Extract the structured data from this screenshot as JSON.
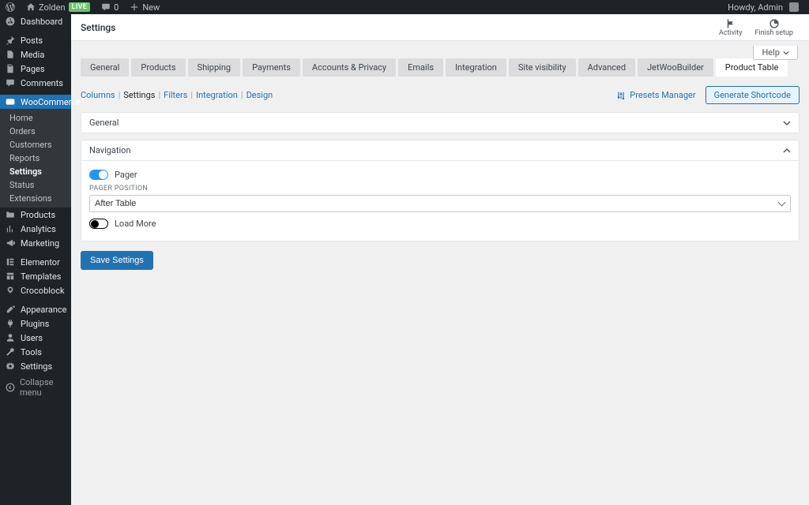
{
  "adminbar": {
    "site": "Zolden",
    "live": "Live",
    "comments": "0",
    "new": "New",
    "howdy": "Howdy, Admin"
  },
  "sidemenu": {
    "dashboard": "Dashboard",
    "posts": "Posts",
    "media": "Media",
    "pages": "Pages",
    "comments": "Comments",
    "woocommerce": "WooCommerce",
    "wc_sub": {
      "home": "Home",
      "orders": "Orders",
      "customers": "Customers",
      "reports": "Reports",
      "settings": "Settings",
      "status": "Status",
      "extensions": "Extensions"
    },
    "products": "Products",
    "analytics": "Analytics",
    "marketing": "Marketing",
    "elementor": "Elementor",
    "templates": "Templates",
    "crocoblock": "Crocoblock",
    "appearance": "Appearance",
    "plugins": "Plugins",
    "users": "Users",
    "tools": "Tools",
    "settings": "Settings",
    "collapse": "Collapse menu"
  },
  "header": {
    "title": "Settings",
    "activity": "Activity",
    "finish": "Finish setup",
    "help": "Help"
  },
  "wc_tabs": [
    "General",
    "Products",
    "Shipping",
    "Payments",
    "Accounts & Privacy",
    "Emails",
    "Integration",
    "Site visibility",
    "Advanced",
    "JetWooBuilder",
    "Product Table"
  ],
  "wc_tab_active": 10,
  "pt_sublinks": [
    "Columns",
    "Settings",
    "Filters",
    "Integration",
    "Design"
  ],
  "pt_active": 1,
  "presets": "Presets Manager",
  "generate": "Generate Shortcode",
  "panel_general": "General",
  "panel_nav": "Navigation",
  "nav": {
    "pager_label": "Pager",
    "pager_pos_label": "Pager position",
    "pager_pos_value": "After Table",
    "loadmore_label": "Load More"
  },
  "save": "Save Settings"
}
